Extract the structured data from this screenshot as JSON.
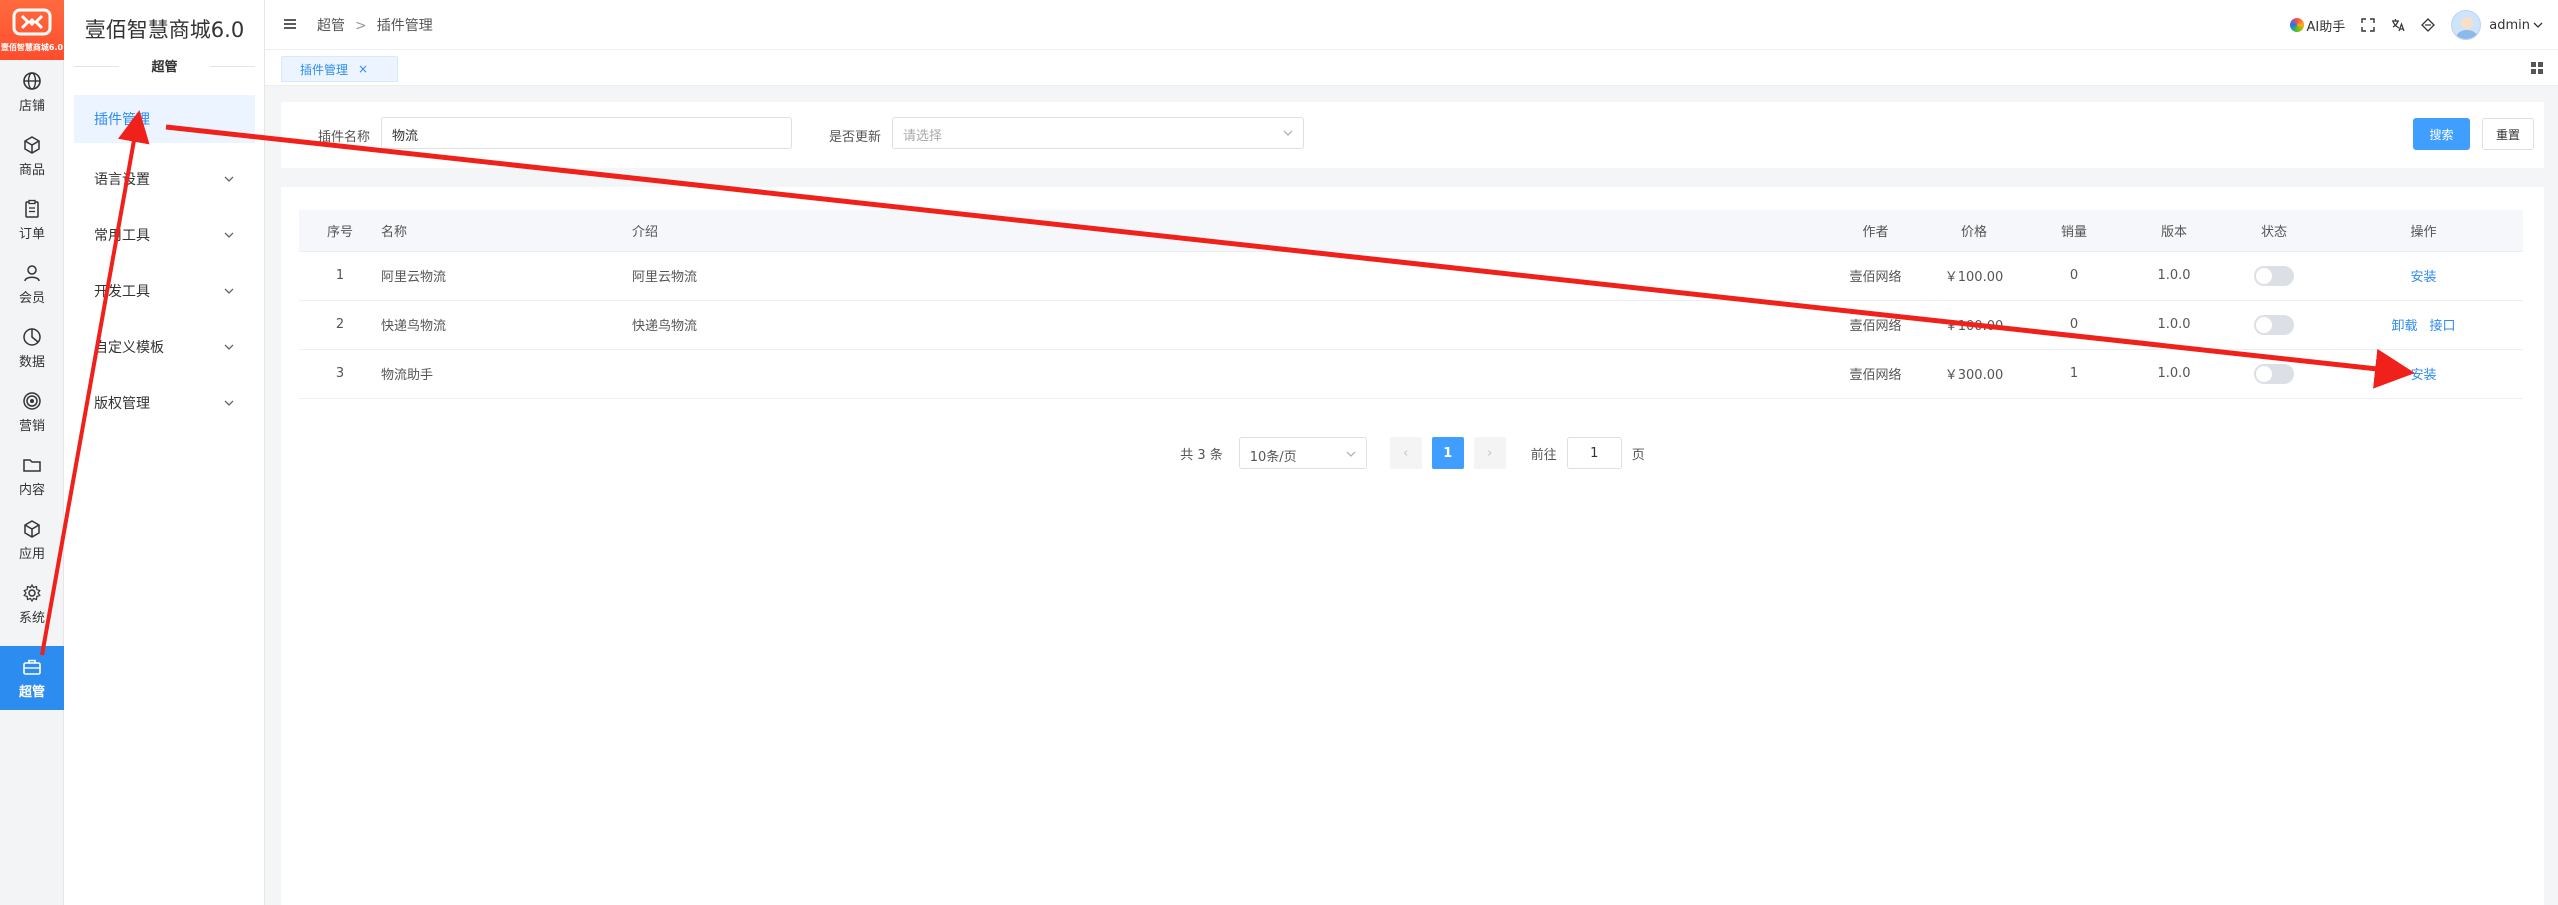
{
  "app": {
    "logo_caption": "壹佰智慧商城6.0",
    "brand_title": "壹佰智慧商城6.0",
    "section_title": "超管"
  },
  "rail": [
    {
      "label": "店铺",
      "icon": "globe-icon"
    },
    {
      "label": "商品",
      "icon": "box-icon"
    },
    {
      "label": "订单",
      "icon": "clipboard-icon"
    },
    {
      "label": "会员",
      "icon": "user-icon"
    },
    {
      "label": "数据",
      "icon": "pie-chart-icon"
    },
    {
      "label": "营销",
      "icon": "target-icon"
    },
    {
      "label": "内容",
      "icon": "folder-icon"
    },
    {
      "label": "应用",
      "icon": "cube-icon"
    },
    {
      "label": "系统",
      "icon": "gear-icon"
    },
    {
      "label": "超管",
      "icon": "briefcase-icon",
      "active": true
    }
  ],
  "submenu": [
    {
      "label": "插件管理",
      "active": true
    },
    {
      "label": "语言设置"
    },
    {
      "label": "常用工具"
    },
    {
      "label": "开发工具"
    },
    {
      "label": "自定义模板"
    },
    {
      "label": "版权管理"
    }
  ],
  "topbar": {
    "breadcrumb": [
      "超管",
      "插件管理"
    ],
    "breadcrumb_sep": ">",
    "ai_label": "AI助手",
    "user": "admin"
  },
  "tabs": [
    {
      "label": "插件管理",
      "close": "×"
    }
  ],
  "filter": {
    "name_label": "插件名称",
    "name_value": "物流",
    "update_label": "是否更新",
    "update_placeholder": "请选择",
    "search_button": "搜索",
    "reset_button": "重置"
  },
  "table": {
    "headers": [
      "序号",
      "名称",
      "介绍",
      "作者",
      "价格",
      "销量",
      "版本",
      "状态",
      "操作"
    ],
    "rows": [
      {
        "no": "1",
        "name": "阿里云物流",
        "intro": "阿里云物流",
        "author": "壹佰网络",
        "price": "￥100.00",
        "sales": "0",
        "version": "1.0.0",
        "actions": [
          "安装"
        ]
      },
      {
        "no": "2",
        "name": "快递鸟物流",
        "intro": "快递鸟物流",
        "author": "壹佰网络",
        "price": "￥100.00",
        "sales": "0",
        "version": "1.0.0",
        "actions": [
          "卸载",
          "接口"
        ]
      },
      {
        "no": "3",
        "name": "物流助手",
        "intro": "",
        "author": "壹佰网络",
        "price": "￥300.00",
        "sales": "1",
        "version": "1.0.0",
        "actions": [
          "安装"
        ]
      }
    ]
  },
  "pagination": {
    "total_text": "共 3 条",
    "page_size": "10条/页",
    "prev": "‹",
    "current": "1",
    "next": "›",
    "goto_label": "前往",
    "goto_value": "1",
    "page_suffix": "页"
  },
  "colors": {
    "accent": "#2d8cf0",
    "annotation_arrow": "#f0201b",
    "logo": "#ff5530"
  }
}
